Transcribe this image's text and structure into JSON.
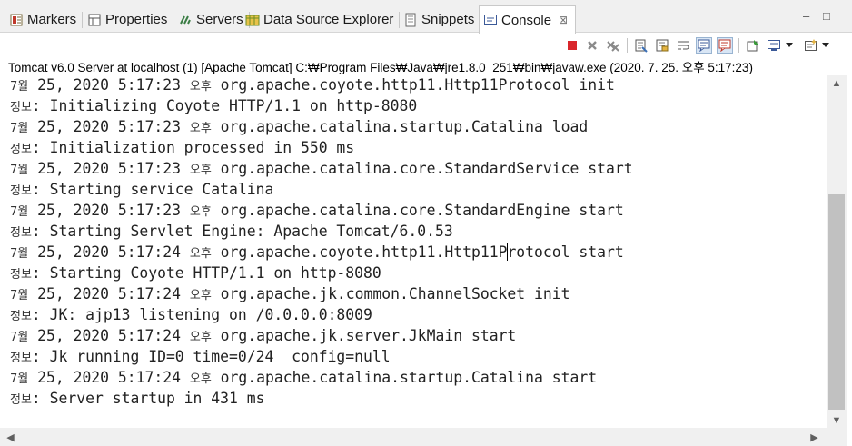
{
  "tabs": [
    {
      "label": "Markers",
      "icon": "markers-icon"
    },
    {
      "label": "Properties",
      "icon": "properties-icon"
    },
    {
      "label": "Servers",
      "icon": "servers-icon"
    },
    {
      "label": "Data Source Explorer",
      "icon": "data-source-icon"
    },
    {
      "label": "Snippets",
      "icon": "snippets-icon"
    },
    {
      "label": "Console",
      "icon": "console-icon",
      "active": true,
      "close": "⊠"
    }
  ],
  "window_controls": {
    "minimize": "–",
    "maximize": "□"
  },
  "toolbar": {
    "icons": [
      "terminate-icon",
      "remove-launch-icon",
      "remove-all-terminated-icon",
      "clear-console-icon",
      "scroll-lock-icon",
      "word-wrap-icon",
      "show-stdout-icon",
      "show-stderr-icon",
      "pin-console-icon",
      "display-console-icon",
      "dropdown-icon",
      "open-console-icon",
      "dropdown-icon"
    ]
  },
  "status": "Tomcat v6.0 Server at localhost (1) [Apache Tomcat] C:₩Program Files₩Java₩jre1.8.0_251₩bin₩javaw.exe (2020. 7. 25. 오후 5:17:23)",
  "console_lines": [
    {
      "pre": "7월",
      "mid": " 25, 2020 5:17:23 ",
      "ampm": "오후",
      "post": " org.apache.coyote.http11.Http11Protocol init"
    },
    {
      "pre": "정보",
      "mid": ": Initializing Coyote HTTP/1.1 on http-8080",
      "ampm": "",
      "post": ""
    },
    {
      "pre": "7월",
      "mid": " 25, 2020 5:17:23 ",
      "ampm": "오후",
      "post": " org.apache.catalina.startup.Catalina load"
    },
    {
      "pre": "정보",
      "mid": ": Initialization processed in 550 ms",
      "ampm": "",
      "post": ""
    },
    {
      "pre": "7월",
      "mid": " 25, 2020 5:17:23 ",
      "ampm": "오후",
      "post": " org.apache.catalina.core.StandardService start"
    },
    {
      "pre": "정보",
      "mid": ": Starting service Catalina",
      "ampm": "",
      "post": ""
    },
    {
      "pre": "7월",
      "mid": " 25, 2020 5:17:23 ",
      "ampm": "오후",
      "post": " org.apache.catalina.core.StandardEngine start"
    },
    {
      "pre": "정보",
      "mid": ": Starting Servlet Engine: Apache Tomcat/6.0.53",
      "ampm": "",
      "post": ""
    },
    {
      "pre": "7월",
      "mid": " 25, 2020 5:17:24 ",
      "ampm": "오후",
      "post": " org.apache.coyote.http11.Http11P",
      "caret": true,
      "post2": "rotocol start"
    },
    {
      "pre": "정보",
      "mid": ": Starting Coyote HTTP/1.1 on http-8080",
      "ampm": "",
      "post": ""
    },
    {
      "pre": "7월",
      "mid": " 25, 2020 5:17:24 ",
      "ampm": "오후",
      "post": " org.apache.jk.common.ChannelSocket init"
    },
    {
      "pre": "정보",
      "mid": ": JK: ajp13 listening on /0.0.0.0:8009",
      "ampm": "",
      "post": ""
    },
    {
      "pre": "7월",
      "mid": " 25, 2020 5:17:24 ",
      "ampm": "오후",
      "post": " org.apache.jk.server.JkMain start"
    },
    {
      "pre": "정보",
      "mid": ": Jk running ID=0 time=0/24  config=null",
      "ampm": "",
      "post": ""
    },
    {
      "pre": "7월",
      "mid": " 25, 2020 5:17:24 ",
      "ampm": "오후",
      "post": " org.apache.catalina.startup.Catalina start"
    },
    {
      "pre": "정보",
      "mid": ": Server startup in 431 ms",
      "ampm": "",
      "post": ""
    }
  ],
  "scrollbars": {
    "up": "▲",
    "down": "▼",
    "left": "◀",
    "right": "▶"
  }
}
